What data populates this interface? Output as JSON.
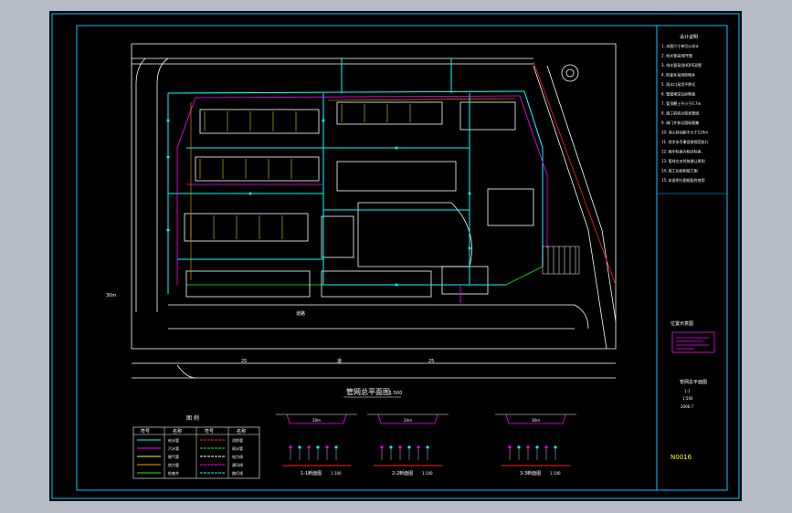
{
  "drawing": {
    "main_title": "管网总平面图",
    "main_scale": "1:500",
    "notes_heading": "设计说明",
    "notes_lines": [
      "1. 本图尺寸单位以米计",
      "2. 给水管采用PE管",
      "3. 排水管采用HDPE双壁",
      "4. 检查井采用砖砌井",
      "5. 雨水口采用平箅式",
      "6. 管道埋深见纵断面",
      "7. 管顶覆土不小于0.7m",
      "8. 施工前核对现状管线",
      "9. 阀门井参见国标图集",
      "10. 消火栓间距不大于120m",
      "11. 其余未尽事宜按规范执行",
      "12. 图中标高为相对标高",
      "13. 管线交叉时按避让原则",
      "14. 竣工后绘制竣工图",
      "15. 本说明与图纸配合使用"
    ],
    "key_plan_label": "位置示意图",
    "info_lines": [
      "管网总平面图",
      "1:1",
      "1:500",
      "2006.7"
    ],
    "drawing_number": "N0016",
    "legend_heading": "图 例",
    "legend_headers": [
      "符号",
      "名称",
      "符号",
      "名称"
    ],
    "legend_rows": [
      [
        "给水管",
        "消防管"
      ],
      [
        "污水管",
        "雨水管"
      ],
      [
        "燃气管",
        "电力线"
      ],
      [
        "热力管",
        "通讯线"
      ],
      [
        "检查井",
        "路灯线"
      ]
    ],
    "sections": [
      {
        "title": "1-1断面图",
        "scale": "1:100",
        "width_label": "20m"
      },
      {
        "title": "2-2断面图",
        "scale": "1:100",
        "width_label": "24m"
      },
      {
        "title": "3-3断面图",
        "scale": "1:100",
        "width_label": "30m"
      }
    ],
    "road_labels": [
      "30m",
      "道路",
      "25",
      "道",
      "25"
    ]
  },
  "colors": {
    "background": "#000000",
    "frame": "#00c8ff",
    "white": "#ffffff",
    "water": "#00ffff",
    "sewer": "#ff00ff",
    "building": "#ffffff",
    "green": "#00ff00",
    "yellow": "#ffff00",
    "red": "#ff2020",
    "orange": "#ff9900"
  }
}
